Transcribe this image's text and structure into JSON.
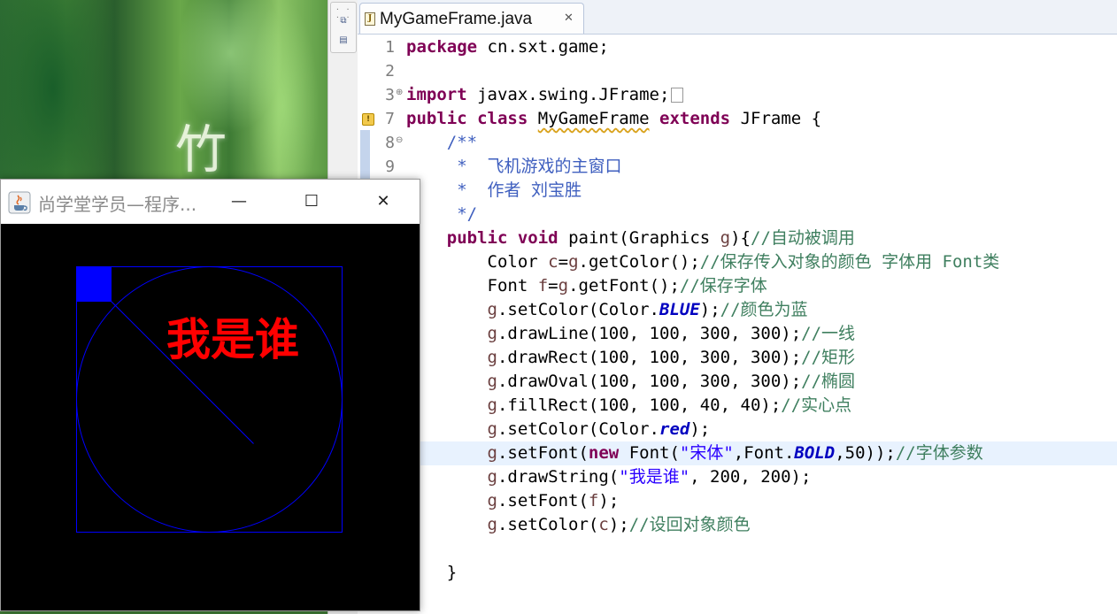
{
  "desktop": {
    "wallpaper_char": "竹"
  },
  "editor": {
    "tab": {
      "title": "MyGameFrame.java",
      "close_glyph": "✕"
    },
    "line_numbers": [
      "1",
      "2",
      "3",
      "7",
      "8",
      "9"
    ],
    "code": {
      "l1_kw": "package",
      "l1_rest": " cn.sxt.game;",
      "l3_kw": "import",
      "l3_rest": " javax.swing.JFrame;",
      "l7_kw1": "public",
      "l7_kw2": "class",
      "l7_name": "MyGameFrame",
      "l7_kw3": "extends",
      "l7_rest": " JFrame {",
      "l8": "    /**",
      "l9": "     *  飞机游戏的主窗口",
      "l10": "     *  作者 刘宝胜",
      "l11": "     */",
      "l12_kw1": "public",
      "l12_kw2": "void",
      "l12_sig": " paint(Graphics ",
      "l12_g": "g",
      "l12_brace": "){",
      "l12_cm": "//自动被调用",
      "l13_a": "Color ",
      "l13_c": "c",
      "l13_eq": "=",
      "l13_g": "g",
      "l13_b": ".getColor();",
      "l13_cm": "//保存传入对象的颜色 字体用 Font类",
      "l14_a": "Font ",
      "l14_f": "f",
      "l14_eq": "=",
      "l14_g": "g",
      "l14_b": ".getFont();",
      "l14_cm": "//保存字体",
      "l15_g": "g",
      "l15_a": ".setColor(Color.",
      "l15_fld": "BLUE",
      "l15_b": ");",
      "l15_cm": "//颜色为蓝",
      "l16_g": "g",
      "l16_a": ".drawLine(100, 100, 300, 300);",
      "l16_cm": "//一线",
      "l17_g": "g",
      "l17_a": ".drawRect(100, 100, 300, 300);",
      "l17_cm": "//矩形",
      "l18_g": "g",
      "l18_a": ".drawOval(100, 100, 300, 300);",
      "l18_cm": "//椭圆",
      "l19_g": "g",
      "l19_a": ".fillRect(100, 100, 40, 40);",
      "l19_cm": "//实心点",
      "l20_g": "g",
      "l20_a": ".setColor(Color.",
      "l20_fld": "red",
      "l20_b": ");",
      "l21_g": "g",
      "l21_a": ".setFont(",
      "l21_kw": "new",
      "l21_b": " Font(",
      "l21_str": "\"宋体\"",
      "l21_c": ",Font.",
      "l21_fld": "BOLD",
      "l21_d": ",50));",
      "l21_cm": "//字体参数",
      "l22_g": "g",
      "l22_a": ".drawString(",
      "l22_str": "\"我是谁\"",
      "l22_b": ", 200, 200);",
      "l23_g": "g",
      "l23_a": ".setFont(",
      "l23_f": "f",
      "l23_b": ");",
      "l24_g": "g",
      "l24_a": ".setColor(",
      "l24_c": "c",
      "l24_b": ");",
      "l24_cm": "//设回对象颜色",
      "l26": "    }"
    }
  },
  "java_window": {
    "title": "尚学堂学员—程序...",
    "minimize_glyph": "—",
    "maximize_glyph": "☐",
    "close_glyph": "✕",
    "canvas_text": "我是谁",
    "colors": {
      "shape": "#0000ff",
      "text": "#ff0000",
      "background": "#000000"
    }
  }
}
